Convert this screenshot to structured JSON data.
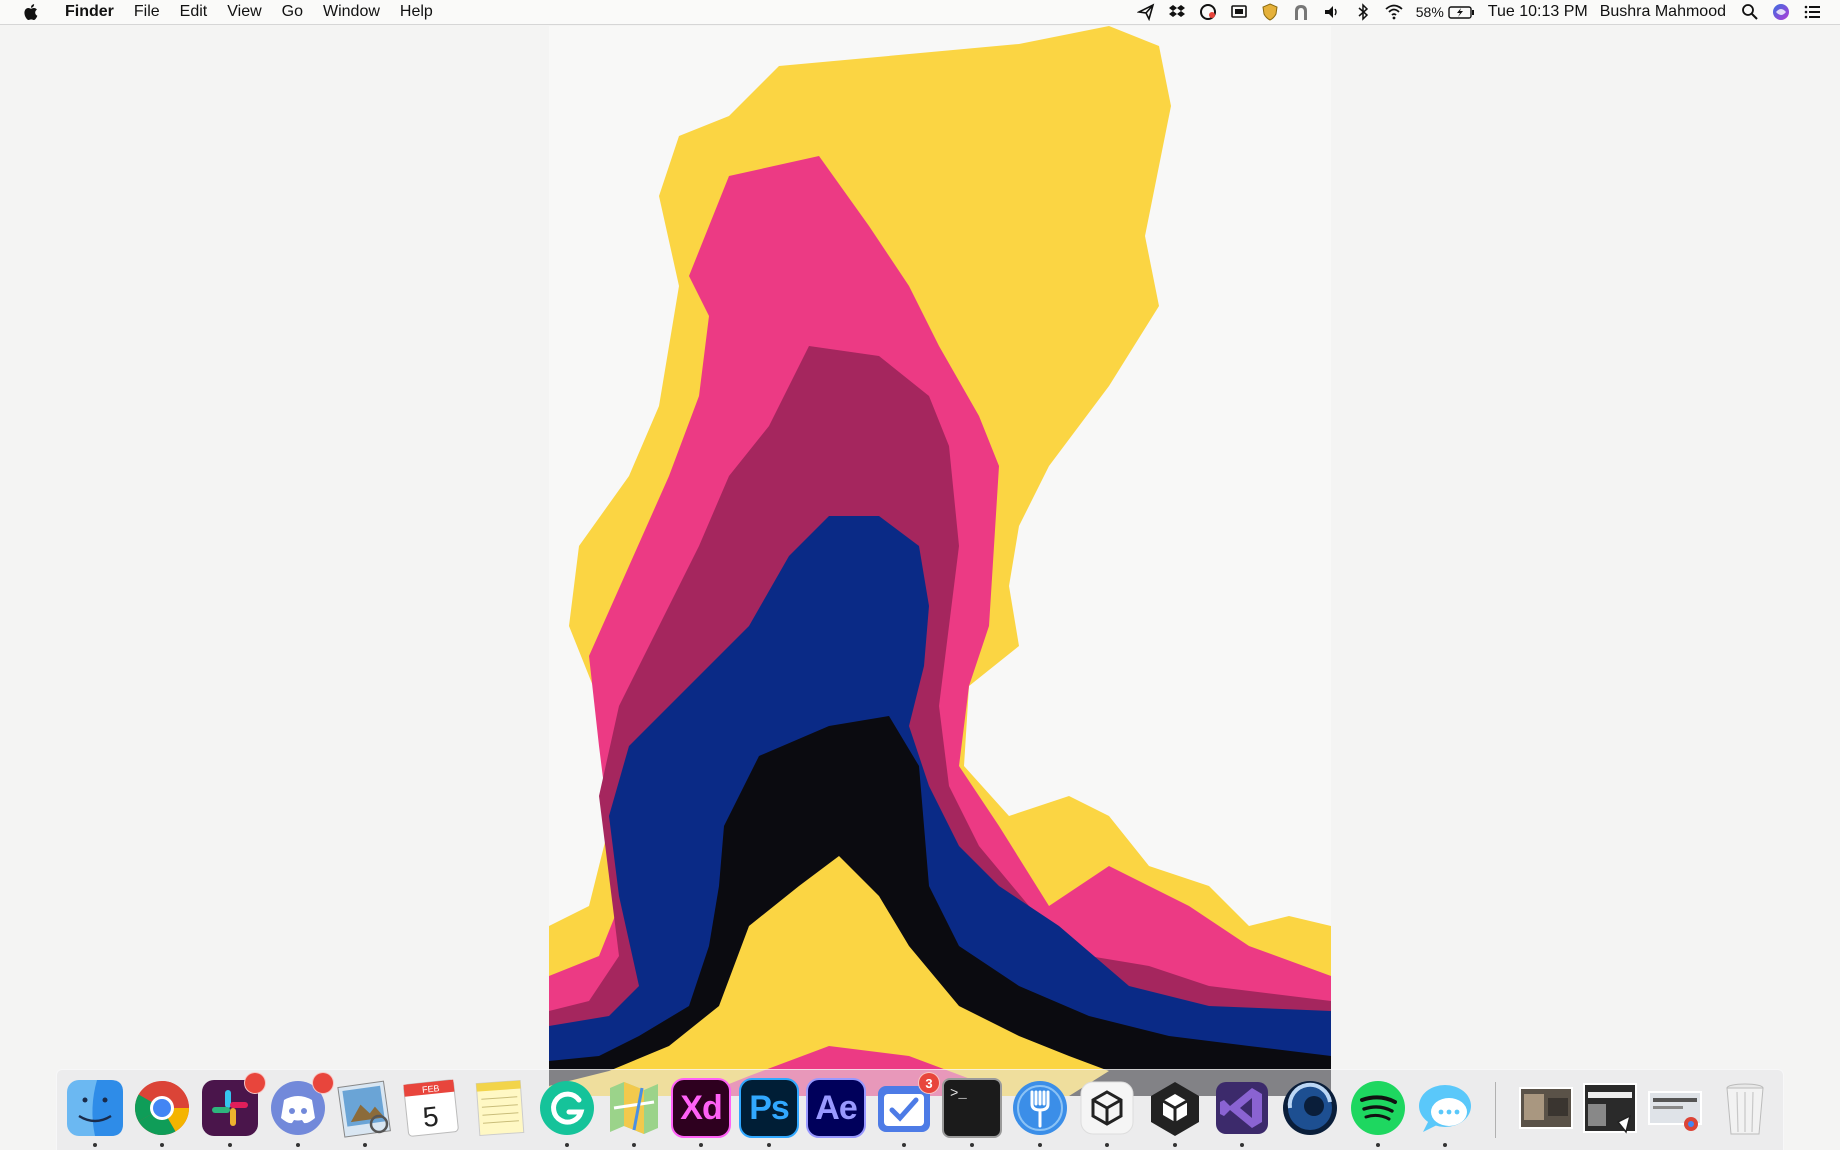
{
  "menubar": {
    "app_name": "Finder",
    "menus": [
      "File",
      "Edit",
      "View",
      "Go",
      "Window",
      "Help"
    ],
    "status": {
      "battery_percent": "58%",
      "datetime": "Tue 10:13 PM",
      "user_name": "Bushra Mahmood"
    },
    "status_icons": [
      "paper-plane-icon",
      "dropbox-icon",
      "creative-cloud-icon",
      "display-icon",
      "shield-icon",
      "arch-icon",
      "volume-icon",
      "bluetooth-icon",
      "wifi-icon",
      "battery-icon",
      "search-icon",
      "siri-icon",
      "list-icon"
    ]
  },
  "wallpaper": {
    "colors": {
      "yellow": "#fbd543",
      "pink": "#ec3a84",
      "magenta": "#a5265e",
      "navy": "#0a2a86",
      "black": "#0b0b10",
      "background": "#f4f4f3"
    }
  },
  "dock": {
    "apps": [
      {
        "name": "finder",
        "running": true
      },
      {
        "name": "chrome",
        "running": true
      },
      {
        "name": "slack",
        "running": true,
        "badge": ""
      },
      {
        "name": "discord",
        "running": true,
        "badge": ""
      },
      {
        "name": "preview",
        "running": true
      },
      {
        "name": "calendar",
        "running": false,
        "month": "FEB",
        "day": "5"
      },
      {
        "name": "notes",
        "running": false
      },
      {
        "name": "grammarly",
        "running": true,
        "label": "G"
      },
      {
        "name": "maps",
        "running": true
      },
      {
        "name": "adobe-xd",
        "running": true,
        "label": "Xd"
      },
      {
        "name": "photoshop",
        "running": true,
        "label": "Ps"
      },
      {
        "name": "after-effects",
        "running": false,
        "label": "Ae"
      },
      {
        "name": "tasks",
        "running": true,
        "badge": "3"
      },
      {
        "name": "terminal",
        "running": true,
        "label": ">_"
      },
      {
        "name": "fork",
        "running": true
      },
      {
        "name": "unity-hub",
        "running": true
      },
      {
        "name": "unity",
        "running": true
      },
      {
        "name": "visual-studio",
        "running": true
      },
      {
        "name": "cinema-4d",
        "running": false
      },
      {
        "name": "spotify",
        "running": true
      },
      {
        "name": "messages",
        "running": true
      }
    ],
    "right_items": [
      "screenshot-thumb-1",
      "screenshot-thumb-2",
      "screenshot-thumb-3",
      "trash"
    ]
  }
}
